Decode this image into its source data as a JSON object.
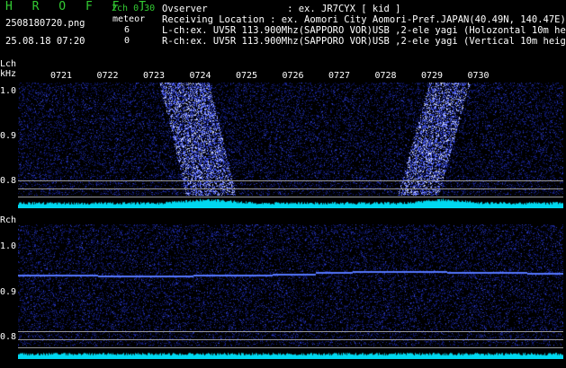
{
  "header": {
    "brand": "H R O F F T",
    "filename": "2508180720.png",
    "datetime": "25.08.18 07:20",
    "channel_mode": "2ch 0.30",
    "meteor_label": "meteor",
    "count_l": "6",
    "count_r": "0",
    "observer_line": "Ovserver              : ex. JR7CYX [ kid ]",
    "location_line": "Receiving Location : ex. Aomori City Aomori-Pref.JAPAN(40.49N, 140.47E)",
    "lch_line": "L-ch:ex. UV5R 113.900Mhz(SAPPORO VOR)USB ,2-ele yagi (Holozontal 10m height)",
    "rch_line": "R-ch:ex. UV5R 113.900Mhz(SAPPORO VOR)USB ,2-ele yagi (Vertical 10m height)"
  },
  "time_axis": [
    "0721",
    "0722",
    "0723",
    "0724",
    "0725",
    "0726",
    "0727",
    "0728",
    "0729",
    "0730"
  ],
  "lch": {
    "label": "Lch",
    "unit": "kHz",
    "y_ticks": [
      "1.0",
      "0.9",
      "0.8"
    ]
  },
  "rch": {
    "label": "Rch",
    "y_ticks": [
      "1.0",
      "0.9",
      "0.8"
    ]
  },
  "colors": {
    "background": "#000000",
    "noise": "#2233aa",
    "signal": "#aabbff",
    "level": "#00e0ff",
    "brand": "#33cc33"
  }
}
